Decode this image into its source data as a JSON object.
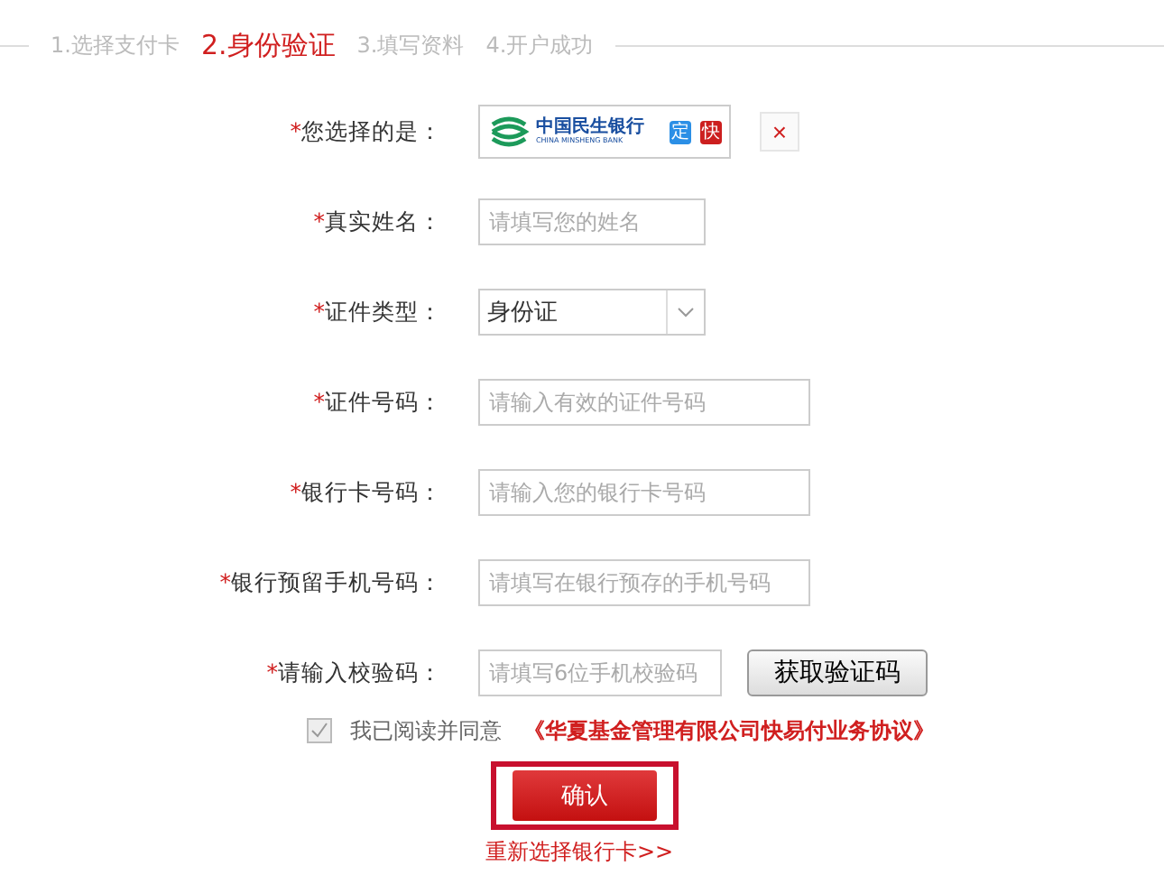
{
  "steps": [
    {
      "label": "1.选择支付卡",
      "selected": false
    },
    {
      "label": "2.身份验证",
      "selected": true
    },
    {
      "label": "3.填写资料",
      "selected": false
    },
    {
      "label": "4.开户成功",
      "selected": false
    }
  ],
  "fields": [
    {
      "kind": "bank",
      "required": "*",
      "label": "您选择的是：",
      "bank_name": "中国民生银行",
      "bank_name_en": "CHINA MINSHENG BANK",
      "badges": [
        {
          "text": "定",
          "color": "#2b8fe6"
        },
        {
          "text": "快",
          "color": "#cc1f1f"
        }
      ],
      "remove": "×"
    },
    {
      "kind": "short_text",
      "required": "*",
      "label": "真实姓名：",
      "placeholder": "请填写您的姓名"
    },
    {
      "kind": "select",
      "required": "*",
      "label": "证件类型：",
      "value": "身份证"
    },
    {
      "kind": "text",
      "required": "*",
      "label": "证件号码：",
      "placeholder": "请输入有效的证件号码"
    },
    {
      "kind": "text",
      "required": "*",
      "label": "银行卡号码：",
      "placeholder": "请输入您的银行卡号码"
    },
    {
      "kind": "text",
      "required": "*",
      "label": "银行预留手机号码：",
      "placeholder": "请填写在银行预存的手机号码"
    },
    {
      "kind": "code",
      "required": "*",
      "label": "请输入校验码：",
      "placeholder": "请填写6位手机校验码",
      "button": "获取验证码"
    }
  ],
  "agreement": {
    "checked": true,
    "text": "我已阅读并同意",
    "link": "《华夏基金管理有限公司快易付业务协议》"
  },
  "confirm": "确认",
  "reselect": "重新选择银行卡>>"
}
